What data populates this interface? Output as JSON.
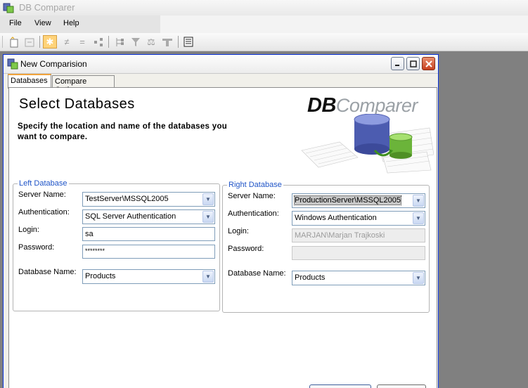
{
  "app": {
    "title": "DB Comparer",
    "menu": [
      "File",
      "View",
      "Help"
    ]
  },
  "toolbar": {
    "buttons": [
      "new-connection-icon",
      "open-icon",
      "star-icon",
      "not-equal-icon",
      "equal-icon",
      "tree-icon",
      "hierarchy-icon",
      "filter-icon",
      "scales-icon",
      "sync-icon",
      "report-icon"
    ]
  },
  "window": {
    "title": "New Comparision",
    "tabs": [
      "Databases",
      "Compare Options"
    ]
  },
  "header": {
    "title": "Select Databases",
    "description": "Specify the location and name of the databases you want to compare.",
    "logo_db": "DB",
    "logo_comparer": "Comparer"
  },
  "left": {
    "legend": "Left Database",
    "server_label": "Server Name:",
    "server_value": "TestServer\\MSSQL2005",
    "auth_label": "Authentication:",
    "auth_value": "SQL Server Authentication",
    "login_label": "Login:",
    "login_value": "sa",
    "password_label": "Password:",
    "password_value": "********",
    "db_label": "Database Name:",
    "db_value": "Products"
  },
  "right": {
    "legend": "Right Database",
    "server_label": "Server Name:",
    "server_value": "ProductionServer\\MSSQL2005",
    "auth_label": "Authentication:",
    "auth_value": "Windows Authentication",
    "login_label": "Login:",
    "login_value": "MARJAN\\Marjan Trajkoski",
    "password_label": "Password:",
    "password_value": "",
    "db_label": "Database Name:",
    "db_value": "Products"
  },
  "colors": {
    "accent_blue": "#1f54c7",
    "tab_highlight": "#f1a33c",
    "close_red": "#c8401e",
    "workspace_gray": "#808080"
  }
}
